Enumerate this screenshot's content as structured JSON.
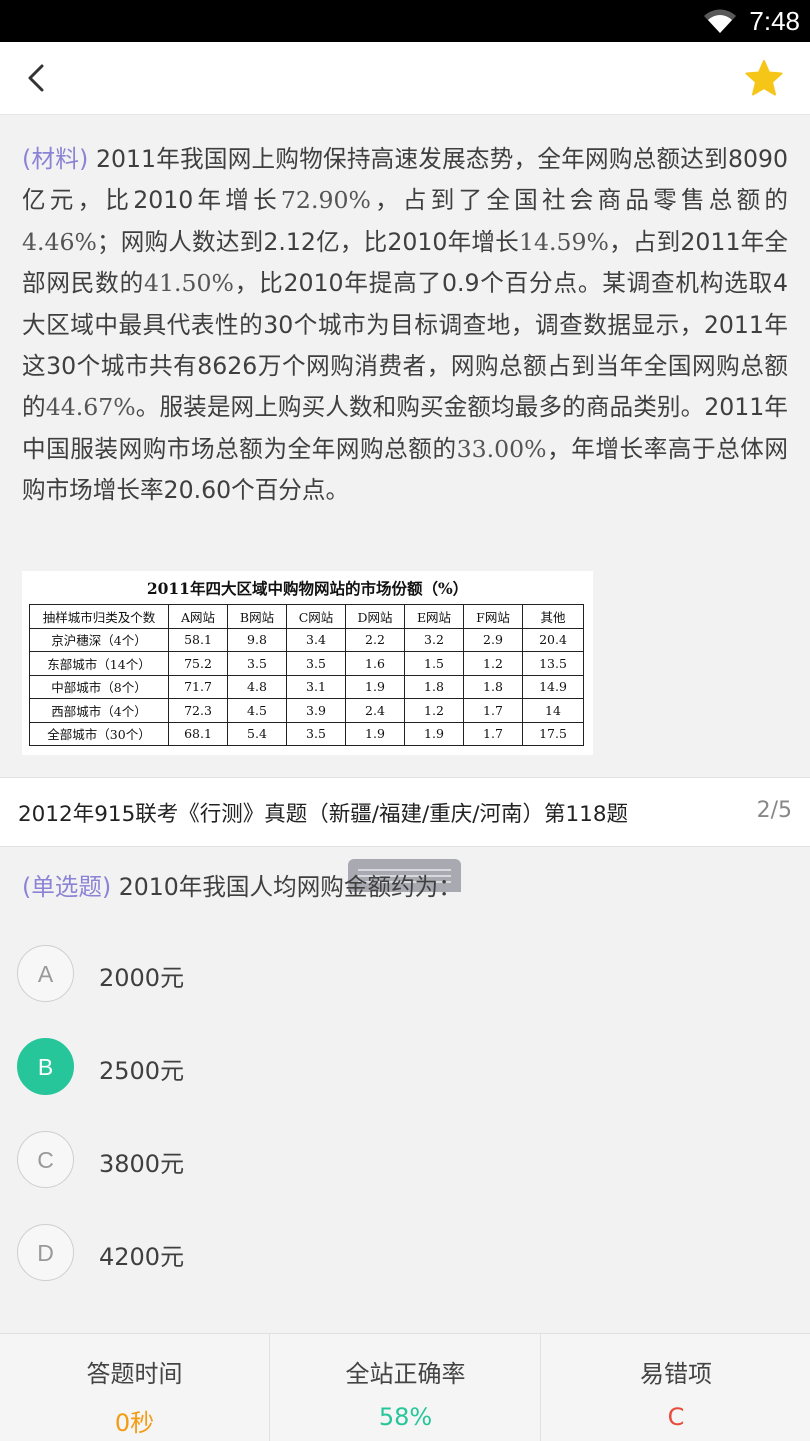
{
  "status_bar": {
    "time": "7:48",
    "wifi_icon": "wifi-icon"
  },
  "app_bar": {
    "back_icon": "chevron-left-icon",
    "favorite_icon": "star-icon",
    "favorite_color": "#f5c518"
  },
  "material": {
    "tag": "(材料)",
    "segments": [
      " 2011年我国网上购物保持高速发展态势，全年网购总额达到8090亿元，比2010年增长",
      "72.90%",
      "，占到了全国社会商品零售总额的",
      "4.46%",
      "；网购人数达到2.12亿，比2010年增长",
      "14.59%",
      "，占到2011年全部网民数的",
      "41.50%",
      "，比2010年提高了0.9个百分点。某调查机构选取4大区域中最具代表性的30个城市为目标调查地，调查数据显示，2011年这30个城市共有8626万个网购消费者，网购总额占到当年全国网购总额的",
      "44.67%",
      "。服装是网上购买人数和购买金额均最多的商品类别。2011年中国服装网购市场总额为全年网购总额的",
      "33.00%",
      "，年增长率高于总体网购市场增长率20.60个百分点。"
    ],
    "table": {
      "title": "2011年四大区域中购物网站的市场份额（%）",
      "headers": [
        "抽样城市归类及个数",
        "A网站",
        "B网站",
        "C网站",
        "D网站",
        "E网站",
        "F网站",
        "其他"
      ],
      "rows": [
        [
          "京沪穗深（4个）",
          "58.1",
          "9.8",
          "3.4",
          "2.2",
          "3.2",
          "2.9",
          "20.4"
        ],
        [
          "东部城市（14个）",
          "75.2",
          "3.5",
          "3.5",
          "1.6",
          "1.5",
          "1.2",
          "13.5"
        ],
        [
          "中部城市（8个）",
          "71.7",
          "4.8",
          "3.1",
          "1.9",
          "1.8",
          "1.8",
          "14.9"
        ],
        [
          "西部城市（4个）",
          "72.3",
          "4.5",
          "3.9",
          "2.4",
          "1.2",
          "1.7",
          "14"
        ],
        [
          "全部城市（30个）",
          "68.1",
          "5.4",
          "3.5",
          "1.9",
          "1.9",
          "1.7",
          "17.5"
        ]
      ]
    }
  },
  "source": {
    "text": "2012年915联考《行测》真题（新疆/福建/重庆/河南）第118题",
    "page": "2/5"
  },
  "question": {
    "tag": "(单选题)",
    "text": " 2010年我国人均网购金额约为："
  },
  "options": [
    {
      "letter": "A",
      "text": "2000元",
      "selected": false
    },
    {
      "letter": "B",
      "text": "2500元",
      "selected": true
    },
    {
      "letter": "C",
      "text": "3800元",
      "selected": false
    },
    {
      "letter": "D",
      "text": "4200元",
      "selected": false
    }
  ],
  "stats": [
    {
      "title": "答题时间",
      "value": "0秒",
      "color": "#f39c12"
    },
    {
      "title": "全站正确率",
      "value": "58%",
      "color": "#26c69a"
    },
    {
      "title": "易错项",
      "value": "C",
      "color": "#e74c3c"
    }
  ],
  "colors": {
    "accent_green": "#26c69a",
    "tag_purple": "#8a83d6"
  }
}
